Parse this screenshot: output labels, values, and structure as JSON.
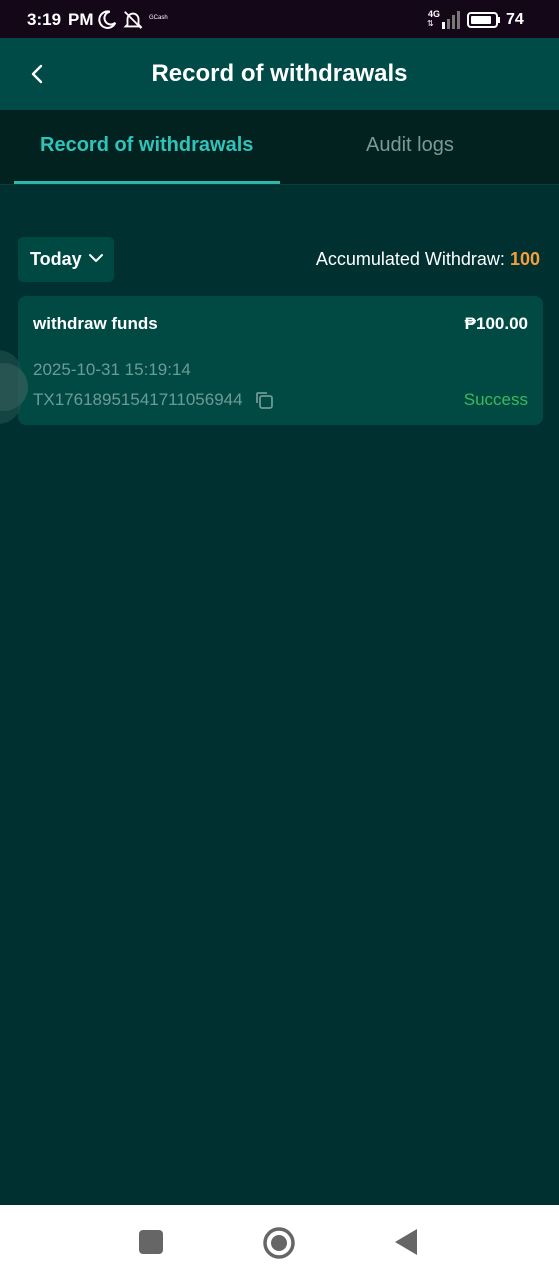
{
  "status_bar": {
    "time": "3:19",
    "ampm": "PM",
    "app_badge": "GCash",
    "network": "4G",
    "battery": "74"
  },
  "header": {
    "title": "Record of withdrawals"
  },
  "tabs": [
    {
      "label": "Record of withdrawals",
      "active": true
    },
    {
      "label": "Audit logs",
      "active": false
    }
  ],
  "filter": {
    "selected": "Today"
  },
  "summary": {
    "label": "Accumulated Withdraw:",
    "value": "100"
  },
  "records": [
    {
      "title": "withdraw funds",
      "amount": "₱100.00",
      "datetime": "2025-10-31 15:19:14",
      "transaction_id": "TX17618951541711056944",
      "status": "Success"
    }
  ],
  "colors": {
    "background": "#00302f",
    "header": "#004a47",
    "accent": "#2fc3ba",
    "highlight": "#f49e3e",
    "success": "#3eb859"
  }
}
